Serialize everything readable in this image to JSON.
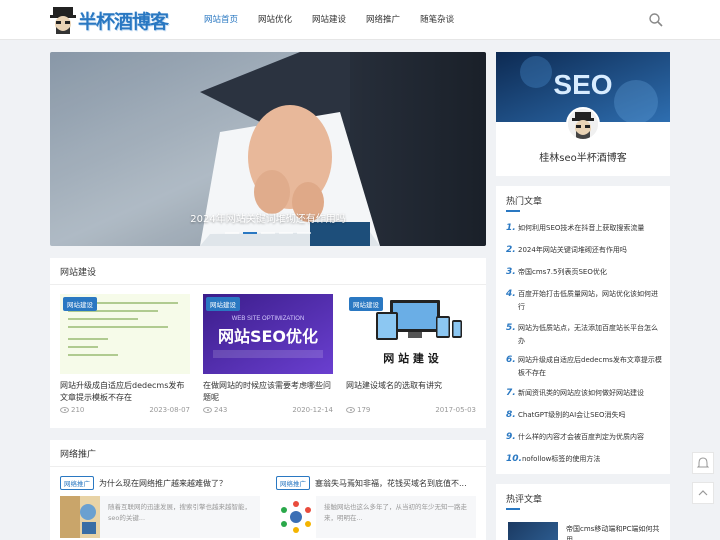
{
  "site": {
    "logo_text": "半杯酒博客"
  },
  "nav": [
    {
      "label": "网站首页",
      "active": true
    },
    {
      "label": "网站优化",
      "active": false
    },
    {
      "label": "网站建设",
      "active": false
    },
    {
      "label": "网络推广",
      "active": false
    },
    {
      "label": "随笔杂谈",
      "active": false
    }
  ],
  "slider": {
    "title": "2024年网站关键词堆砌还有作用吗",
    "slide_count": 5,
    "active_index": 1
  },
  "profile": {
    "banner_text": "SEO",
    "name": "桂林seo半杯酒博客"
  },
  "hot": {
    "title": "热门文章",
    "items": [
      {
        "num": "1.",
        "text": "如何利用SEO技术在抖音上获取搜索流量"
      },
      {
        "num": "2.",
        "text": "2024年网站关键词堆砌还有作用吗"
      },
      {
        "num": "3.",
        "text": "帝国cms7.5列表页SEO优化"
      },
      {
        "num": "4.",
        "text": "百度开始打击低质量网站，网站优化该如何进行"
      },
      {
        "num": "5.",
        "text": "网站为低质站点，无法添加百度站长平台怎么办"
      },
      {
        "num": "6.",
        "text": "网站升级成自适应后dedecms发布文章提示模板不存在"
      },
      {
        "num": "7.",
        "text": "新闻资讯类的网站应该如何做好网站建设"
      },
      {
        "num": "8.",
        "text": "ChatGPT级别的AI会让SEO消失吗"
      },
      {
        "num": "9.",
        "text": "什么样的内容才会被百度判定为优质内容"
      },
      {
        "num": "10.",
        "text": "nofollow标签的使用方法"
      }
    ]
  },
  "comments": {
    "title": "热评文章",
    "first_text": "帝国cms移动端和PC端如何共用..."
  },
  "build": {
    "title": "网站建设",
    "posts": [
      {
        "tag": "网站建设",
        "title": "网站升级成自适应后dedecms发布文章提示模板不存在",
        "views": "210",
        "date": "2023-08-07",
        "thumb_text": ""
      },
      {
        "tag": "网站建设",
        "title": "在做网站的时候应该需要考虑哪些问题呢",
        "views": "243",
        "date": "2020-12-14",
        "thumb_text": "网站SEO优化"
      },
      {
        "tag": "网站建设",
        "title": "网站建设域名的选取有讲究",
        "views": "179",
        "date": "2017-05-03",
        "thumb_text": "网 站 建 设"
      }
    ]
  },
  "promo": {
    "title": "网络推广",
    "posts": [
      {
        "tag": "网络推广",
        "title": "为什么现在网络推广越来越难做了？",
        "desc": "随着互联网的迅速发展，搜索引擎也越来越智能，seo的关键..."
      },
      {
        "tag": "网络推广",
        "title": "塞翁失马焉知非福，花钱买域名到底值不...",
        "desc": "接触网站也这么多年了，从当初的年少无知一路走来，明明在..."
      }
    ]
  },
  "colors": {
    "accent": "#2a78c2"
  }
}
